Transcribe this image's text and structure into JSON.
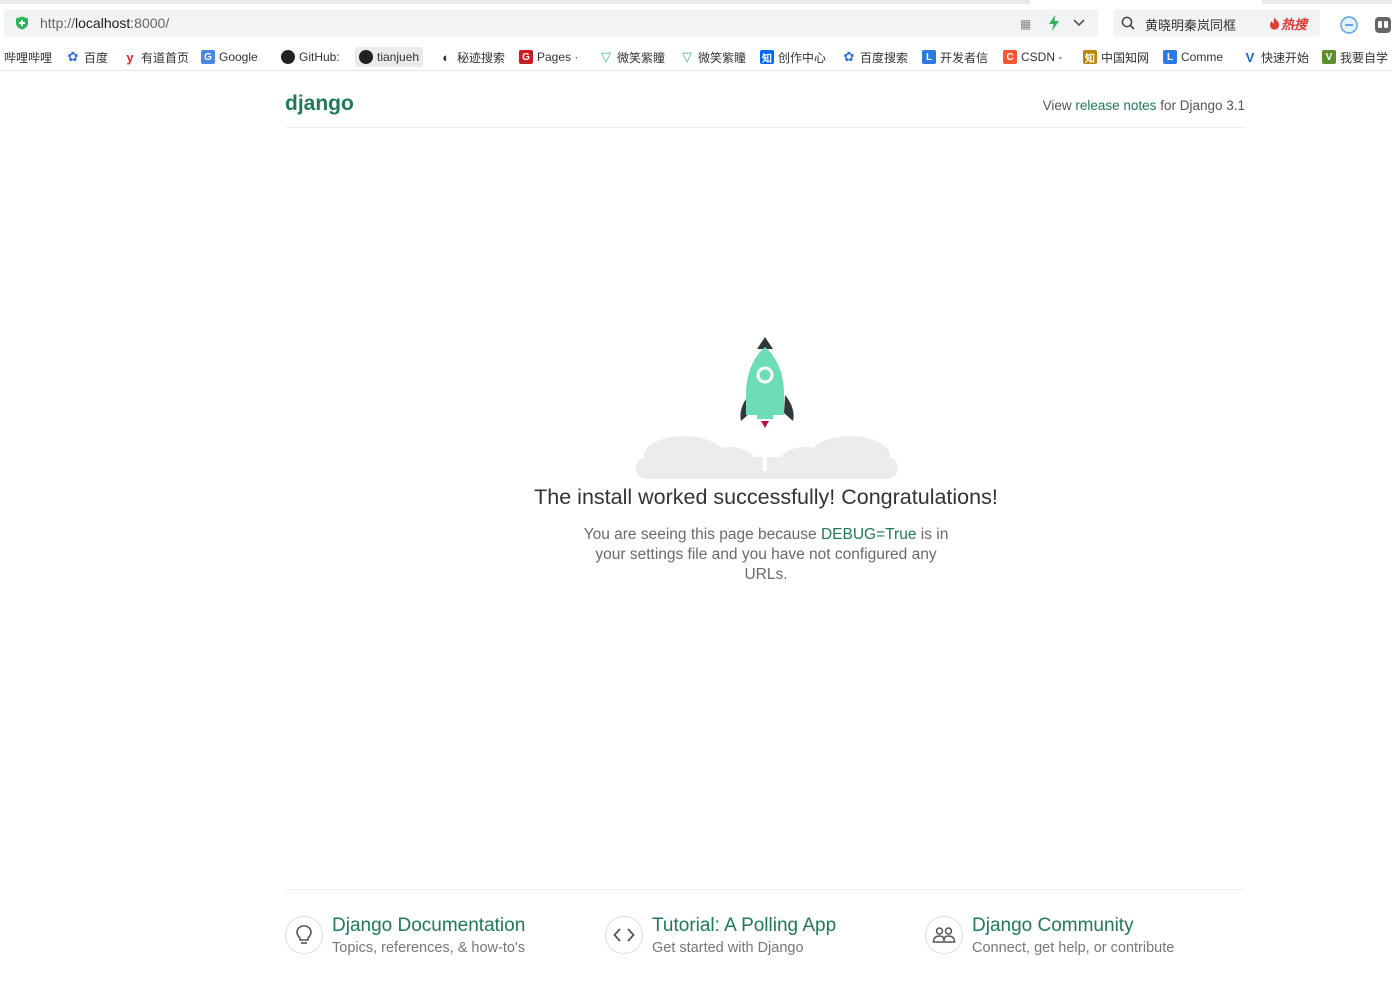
{
  "browser": {
    "url_prefix": "http://",
    "url_host": "localhost",
    "url_suffix": ":8000/",
    "qr_glyph": "▦",
    "search_text": "黄晓明秦岚同框",
    "hot_label": "热搜",
    "bookmarks": [
      {
        "label": "哔哩哔哩",
        "icon": "bilibili-icon",
        "color": "#ffffff"
      },
      {
        "label": "百度",
        "icon": "baidu-paw-icon",
        "color": "#2f6fe0"
      },
      {
        "label": "有道首页",
        "icon": "youdao-icon",
        "color": "#e3262d"
      },
      {
        "label": "Google",
        "icon": "google-translate-icon",
        "color": "#4a86e8"
      },
      {
        "label": "GitHub:",
        "icon": "github-icon",
        "color": "#222222"
      },
      {
        "label": "tianjueh",
        "icon": "github-icon",
        "color": "#222222"
      },
      {
        "label": "秘迹搜索",
        "icon": "mijisou-icon",
        "color": "#333333"
      },
      {
        "label": "Pages ·",
        "icon": "gitee-icon",
        "color": "#c71d23"
      },
      {
        "label": "微笑紫瞳",
        "icon": "vue-icon",
        "color": "#42b883"
      },
      {
        "label": "微笑紫瞳",
        "icon": "vue-icon",
        "color": "#42b883"
      },
      {
        "label": "创作中心",
        "icon": "zhihu-icon",
        "color": "#0066ff"
      },
      {
        "label": "百度搜索",
        "icon": "baidu-paw-icon",
        "color": "#2f6fe0"
      },
      {
        "label": "开发者信",
        "icon": "l-icon",
        "color": "#2a7ae2"
      },
      {
        "label": "CSDN -",
        "icon": "csdn-icon",
        "color": "#fc5531"
      },
      {
        "label": "中国知网",
        "icon": "cnki-icon",
        "color": "#b8860b"
      },
      {
        "label": "Comme",
        "icon": "l-icon",
        "color": "#2a7ae2"
      },
      {
        "label": "快速开始",
        "icon": "v-icon",
        "color": "#1565c0"
      },
      {
        "label": "我要自学",
        "icon": "v-green-icon",
        "color": "#5a8f29"
      }
    ]
  },
  "header": {
    "logo": "django",
    "release_prefix": "View ",
    "release_link": "release notes",
    "release_suffix": " for Django 3.1"
  },
  "main": {
    "headline": "The install worked successfully! Congratulations!",
    "sub_prefix": "You are seeing this page because ",
    "sub_debug": "DEBUG=True",
    "sub_suffix": " is in your settings file and you have not configured any URLs."
  },
  "footer": {
    "cards": [
      {
        "title": "Django Documentation",
        "desc": "Topics, references, & how-to's",
        "icon": "lightbulb-icon"
      },
      {
        "title": "Tutorial: A Polling App",
        "desc": "Get started with Django",
        "icon": "code-icon"
      },
      {
        "title": "Django Community",
        "desc": "Connect, get help, or contribute",
        "icon": "people-icon"
      }
    ]
  },
  "colors": {
    "django_green": "#1f7a55",
    "rocket_body": "#6dddb8",
    "rocket_dark": "#30383d",
    "cloud": "#ececec",
    "flame": "#b3143c"
  }
}
